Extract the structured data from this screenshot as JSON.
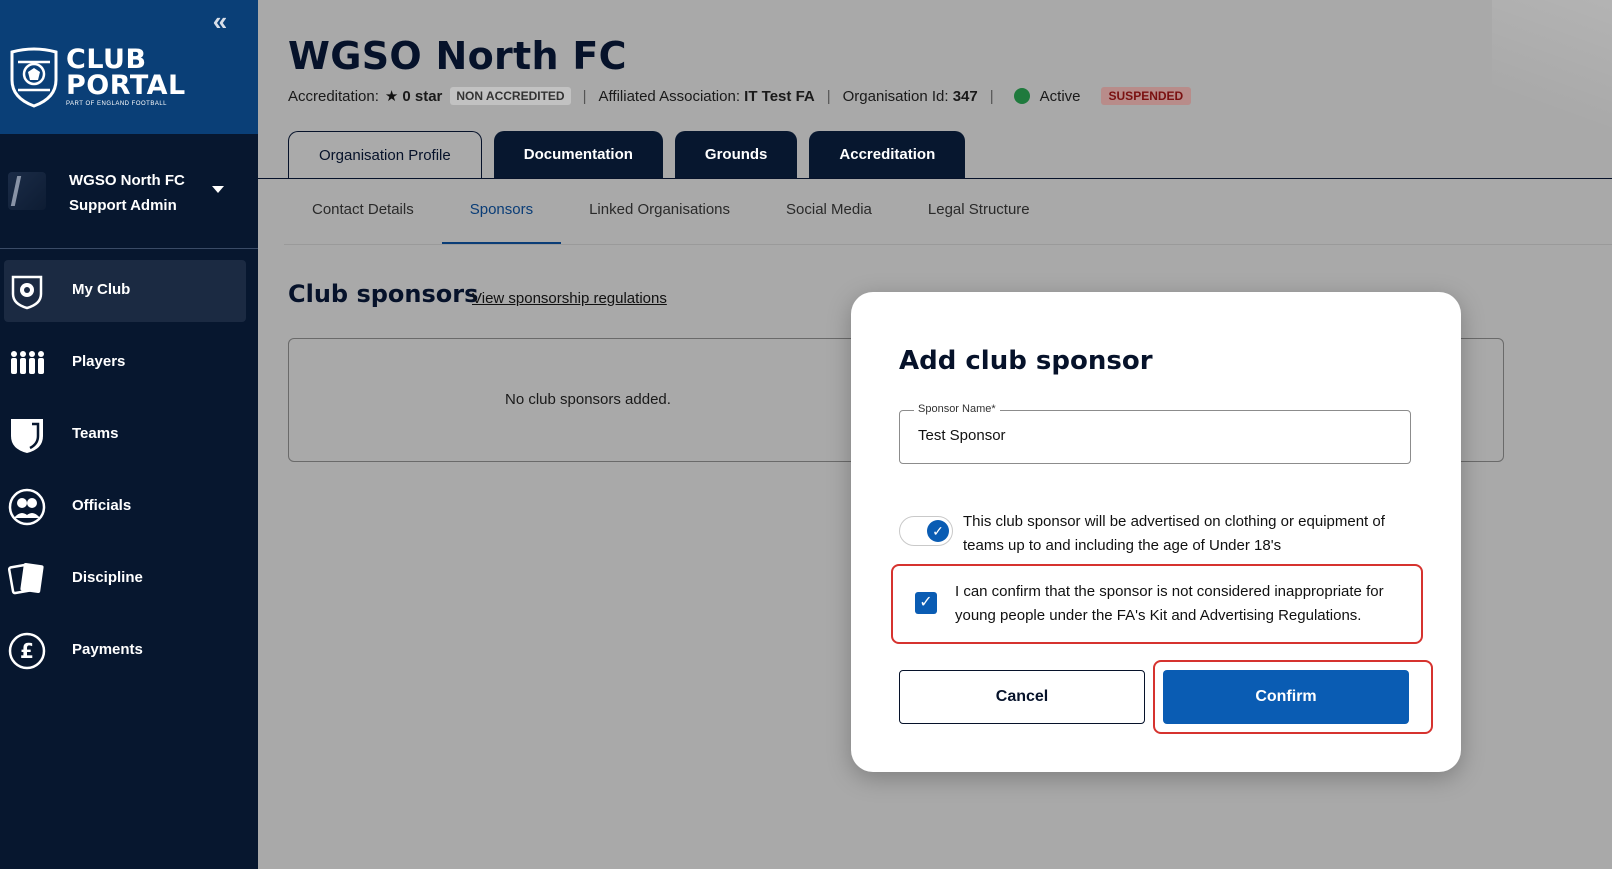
{
  "sidebar": {
    "collapse_label": "«",
    "logo": {
      "title_line1": "CLUB",
      "title_line2": "PORTAL",
      "subtitle": "PART OF ENGLAND FOOTBALL"
    },
    "user": {
      "org": "WGSO North FC",
      "role": "Support Admin"
    },
    "nav": [
      {
        "label": "My Club",
        "icon": "club-crest-icon",
        "active": true
      },
      {
        "label": "Players",
        "icon": "players-icon",
        "active": false
      },
      {
        "label": "Teams",
        "icon": "shield-icon",
        "active": false
      },
      {
        "label": "Officials",
        "icon": "officials-icon",
        "active": false
      },
      {
        "label": "Discipline",
        "icon": "cards-icon",
        "active": false
      },
      {
        "label": "Payments",
        "icon": "pound-icon",
        "active": false
      }
    ]
  },
  "header": {
    "title": "WGSO North FC",
    "accreditation_label": "Accreditation:",
    "accreditation_value": "0 star",
    "accreditation_badge": "NON ACCREDITED",
    "association_label": "Affiliated Association:",
    "association_value": "IT Test FA",
    "org_id_label": "Organisation Id:",
    "org_id_value": "347",
    "status": "Active",
    "status_badge": "SUSPENDED",
    "separator": "|"
  },
  "tabs": [
    {
      "label": "Organisation Profile",
      "active": true
    },
    {
      "label": "Documentation",
      "active": false
    },
    {
      "label": "Grounds",
      "active": false
    },
    {
      "label": "Accreditation",
      "active": false
    }
  ],
  "subtabs": [
    {
      "label": "Contact Details",
      "active": false
    },
    {
      "label": "Sponsors",
      "active": true
    },
    {
      "label": "Linked Organisations",
      "active": false
    },
    {
      "label": "Social Media",
      "active": false
    },
    {
      "label": "Legal Structure",
      "active": false
    }
  ],
  "section": {
    "title": "Club sponsors",
    "link": "View sponsorship regulations",
    "empty_text": "No club sponsors added."
  },
  "modal": {
    "title": "Add club sponsor",
    "field_label": "Sponsor Name*",
    "field_value": "Test Sponsor",
    "toggle_text": "This club sponsor will be advertised on clothing or equipment of teams up to and including the age of Under 18's",
    "toggle_on": true,
    "confirm_text": "I can confirm that the sponsor is not considered inappropriate for young people under the FA's Kit and Advertising Regulations.",
    "confirm_checked": true,
    "cancel_label": "Cancel",
    "confirm_label": "Confirm"
  },
  "colors": {
    "sidebar_bg": "#07172f",
    "sidebar_header": "#0a3f77",
    "accent": "#0a5cb3",
    "highlight": "#d6332f",
    "active_status": "#1f7a3d"
  }
}
